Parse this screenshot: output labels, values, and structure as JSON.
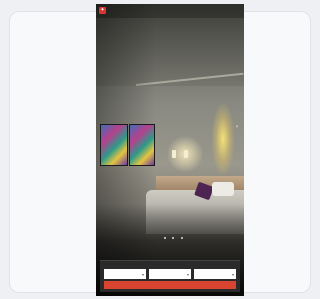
{
  "colors": {
    "accent": "#d94430",
    "logo": "#d8362f",
    "background": "#eef0f3"
  },
  "nav": {
    "logo_icon": "brand-logo-icon",
    "links": [
      "",
      "",
      ""
    ],
    "right_links": [
      "",
      ""
    ]
  },
  "side": {
    "top_text": "",
    "arrow_icon": "chevron-right-icon"
  },
  "hero": {
    "title": "",
    "subtitle": "",
    "slide_count": 3
  },
  "booking": {
    "label": "",
    "right_label": "",
    "fields": [
      {
        "label": "",
        "value": "",
        "icon": "calendar-icon"
      },
      {
        "label": "",
        "value": "",
        "icon": "calendar-icon"
      },
      {
        "label": "",
        "value": "",
        "icon": "guests-icon"
      }
    ],
    "cta_label": ""
  }
}
